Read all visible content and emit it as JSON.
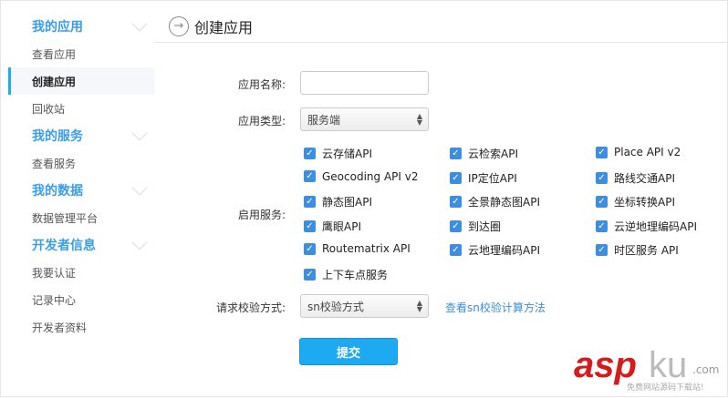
{
  "sidebar": {
    "groups": [
      {
        "title": "我的应用",
        "items": [
          "查看应用",
          "创建应用",
          "回收站"
        ]
      },
      {
        "title": "我的服务",
        "items": [
          "查看服务"
        ]
      },
      {
        "title": "我的数据",
        "items": [
          "数据管理平台"
        ]
      },
      {
        "title": "开发者信息",
        "items": [
          "我要认证",
          "记录中心",
          "开发者资料"
        ]
      }
    ],
    "active": "创建应用"
  },
  "header": {
    "title": "创建应用"
  },
  "form": {
    "name_label": "应用名称:",
    "name_value": "",
    "type_label": "应用类型:",
    "type_value": "服务端",
    "services_label": "启用服务:",
    "services": [
      "云存储API",
      "云检索API",
      "Place API v2",
      "Geocoding API v2",
      "IP定位API",
      "路线交通API",
      "静态图API",
      "全景静态图API",
      "坐标转换API",
      "鹰眼API",
      "到达圈",
      "云逆地理编码API",
      "Routematrix API",
      "云地理编码API",
      "时区服务 API",
      "上下车点服务"
    ],
    "verify_label": "请求校验方式:",
    "verify_value": "sn校验方式",
    "verify_link": "查看sn校验计算方法",
    "submit": "提交"
  },
  "watermark": {
    "brand1": "asp",
    "brand2": "ku",
    ".com": ".com",
    "slogan": "免费网站源码下载站!"
  },
  "colors": {
    "accent": "#1eaaf1",
    "group": "#3a9ee6",
    "checkbox": "#3b8ee0"
  }
}
